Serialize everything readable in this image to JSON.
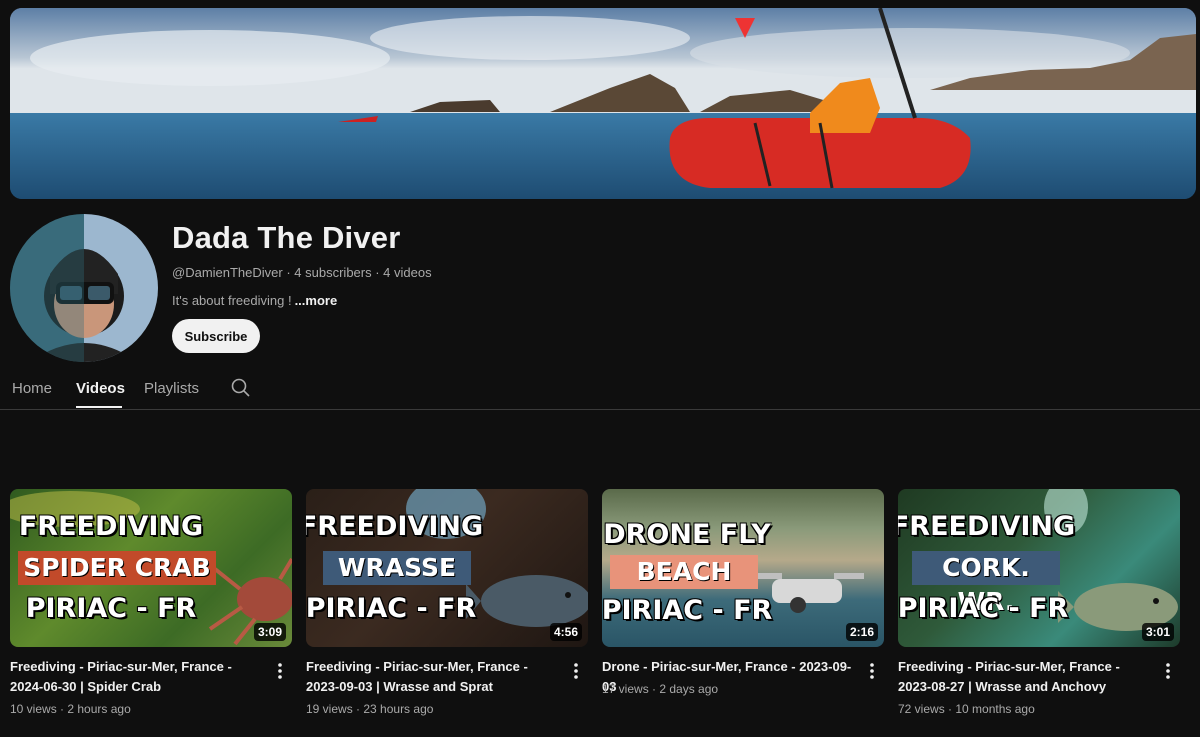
{
  "channel": {
    "name": "Dada The Diver",
    "handle": "@DamienTheDiver",
    "subscribers": "4 subscribers",
    "videos_count": "4 videos",
    "separator": " · ",
    "description": "It's about freediving !",
    "more_label": "...more",
    "subscribe_label": "Subscribe"
  },
  "tabs": [
    {
      "label": "Home"
    },
    {
      "label": "Videos"
    },
    {
      "label": "Playlists"
    }
  ],
  "active_tab": "Videos",
  "videos": [
    {
      "title": "Freediving - Piriac-sur-Mer, France - 2024-06-30 | Spider Crab",
      "views": "10 views",
      "age": "2 hours ago",
      "duration": "3:09",
      "thumb_line1": "FREEDIVING",
      "thumb_line2": "SPIDER CRAB",
      "thumb_line3": "PIRIAC - FR"
    },
    {
      "title": "Freediving - Piriac-sur-Mer, France - 2023-09-03 | Wrasse and Sprat",
      "views": "19 views",
      "age": "23 hours ago",
      "duration": "4:56",
      "thumb_line1": "FREEDIVING",
      "thumb_line2": "WRASSE",
      "thumb_line3": "PIRIAC - FR"
    },
    {
      "title": "Drone - Piriac-sur-Mer, France - 2023-09-03",
      "views": "17 views",
      "age": "2 days ago",
      "duration": "2:16",
      "thumb_line1": "DRONE FLY",
      "thumb_line2": "BEACH",
      "thumb_line3": "PIRIAC - FR"
    },
    {
      "title": "Freediving - Piriac-sur-Mer, France - 2023-08-27 | Wrasse and Anchovy",
      "views": "72 views",
      "age": "10 months ago",
      "duration": "3:01",
      "thumb_line1": "FREEDIVING",
      "thumb_line2": "CORK. WR.",
      "thumb_line3": "PIRIAC - FR"
    }
  ],
  "meta_separator": " · ",
  "colors": {
    "background": "#0f0f0f",
    "text_primary": "#f1f1f1",
    "text_secondary": "#aaaaaa",
    "subscribe_bg": "#f1f1f1"
  },
  "icons": {
    "search": "search-icon",
    "more": "kebab-menu-icon"
  }
}
